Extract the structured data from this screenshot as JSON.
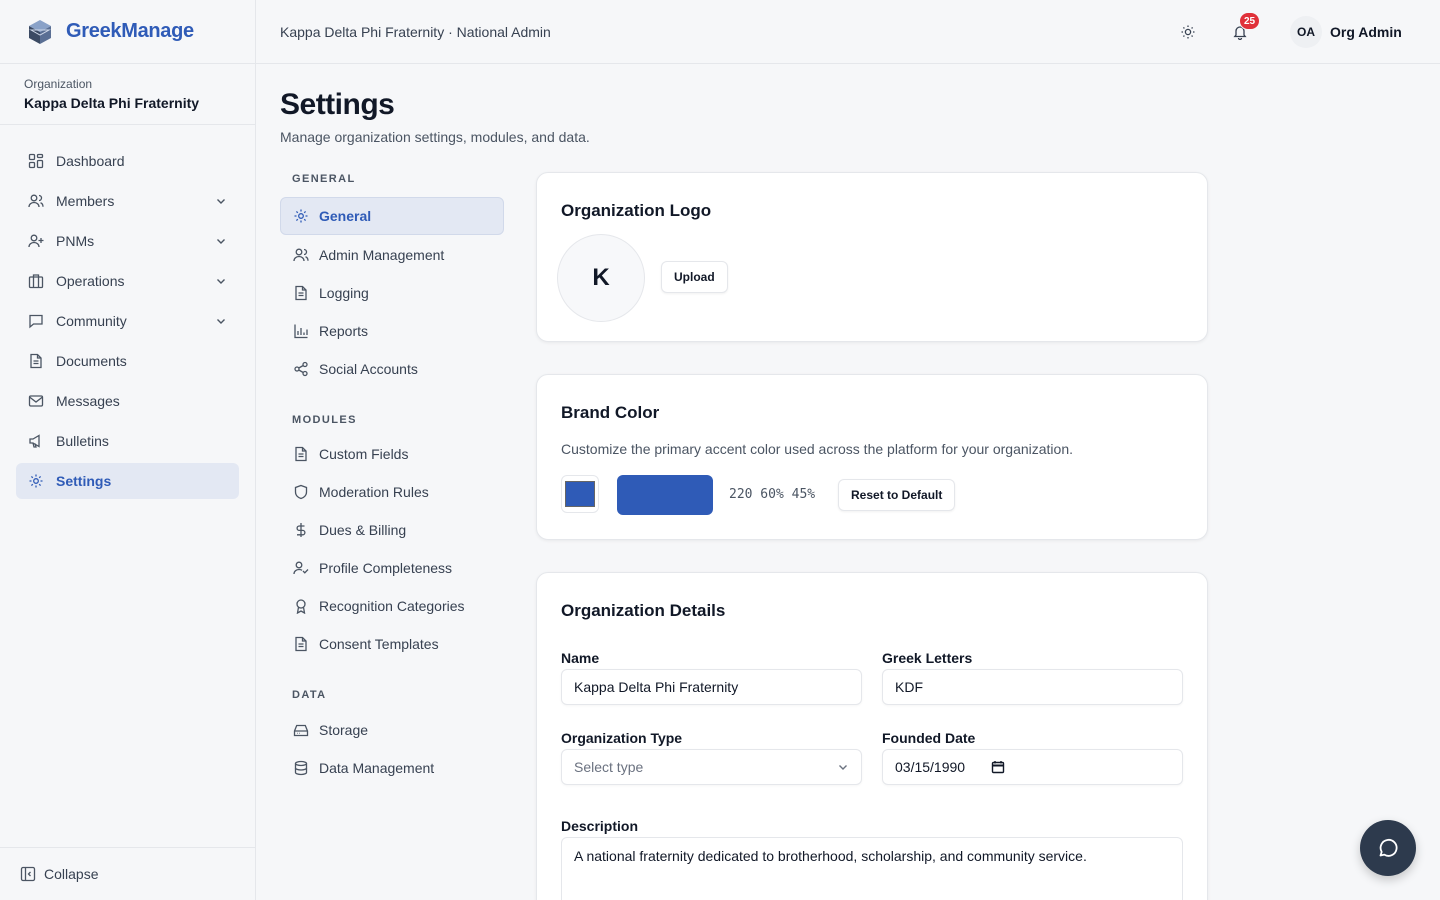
{
  "brand": {
    "name": "GreekManage",
    "logo_icon": "cube-logo-icon"
  },
  "organization": {
    "label": "Organization",
    "name": "Kappa Delta Phi Fraternity"
  },
  "sidebar": {
    "items": [
      {
        "label": "Dashboard",
        "icon": "dashboard-icon"
      },
      {
        "label": "Members",
        "icon": "users-icon",
        "expandable": true
      },
      {
        "label": "PNMs",
        "icon": "user-plus-icon",
        "expandable": true
      },
      {
        "label": "Operations",
        "icon": "building-icon",
        "expandable": true
      },
      {
        "label": "Community",
        "icon": "chat-icon",
        "expandable": true
      },
      {
        "label": "Documents",
        "icon": "document-icon"
      },
      {
        "label": "Messages",
        "icon": "mail-icon"
      },
      {
        "label": "Bulletins",
        "icon": "megaphone-icon"
      },
      {
        "label": "Settings",
        "icon": "gear-icon",
        "active": true
      }
    ],
    "collapse_label": "Collapse"
  },
  "header": {
    "title": "Kappa Delta Phi Fraternity · National Admin",
    "notification_count": "25",
    "user_initials": "OA",
    "user_name": "Org Admin"
  },
  "page": {
    "title": "Settings",
    "subtitle": "Manage organization settings, modules, and data."
  },
  "settings_nav": {
    "general_heading": "GENERAL",
    "general": [
      {
        "label": "General",
        "icon": "gear-icon",
        "active": true
      },
      {
        "label": "Admin Management",
        "icon": "users-icon"
      },
      {
        "label": "Logging",
        "icon": "document-icon"
      },
      {
        "label": "Reports",
        "icon": "bar-chart-icon"
      },
      {
        "label": "Social Accounts",
        "icon": "share-icon"
      }
    ],
    "modules_heading": "MODULES",
    "modules": [
      {
        "label": "Custom Fields",
        "icon": "document-icon"
      },
      {
        "label": "Moderation Rules",
        "icon": "shield-icon"
      },
      {
        "label": "Dues & Billing",
        "icon": "dollar-icon"
      },
      {
        "label": "Profile Completeness",
        "icon": "user-check-icon"
      },
      {
        "label": "Recognition Categories",
        "icon": "award-icon"
      },
      {
        "label": "Consent Templates",
        "icon": "document-icon"
      }
    ],
    "data_heading": "DATA",
    "data": [
      {
        "label": "Storage",
        "icon": "hard-drive-icon"
      },
      {
        "label": "Data Management",
        "icon": "database-icon"
      }
    ]
  },
  "logo_card": {
    "title": "Organization Logo",
    "initial": "K",
    "upload_label": "Upload"
  },
  "brand_color_card": {
    "title": "Brand Color",
    "description": "Customize the primary accent color used across the platform for your organization.",
    "color_hex": "#2f5bb7",
    "hsl_text": "220 60% 45%",
    "reset_label": "Reset to Default"
  },
  "details_card": {
    "title": "Organization Details",
    "name_label": "Name",
    "name_value": "Kappa Delta Phi Fraternity",
    "greek_label": "Greek Letters",
    "greek_value": "KDF",
    "type_label": "Organization Type",
    "type_placeholder": "Select type",
    "founded_label": "Founded Date",
    "founded_value": "03/15/1990",
    "description_label": "Description",
    "description_value": "A national fraternity dedicated to brotherhood, scholarship, and community service."
  }
}
